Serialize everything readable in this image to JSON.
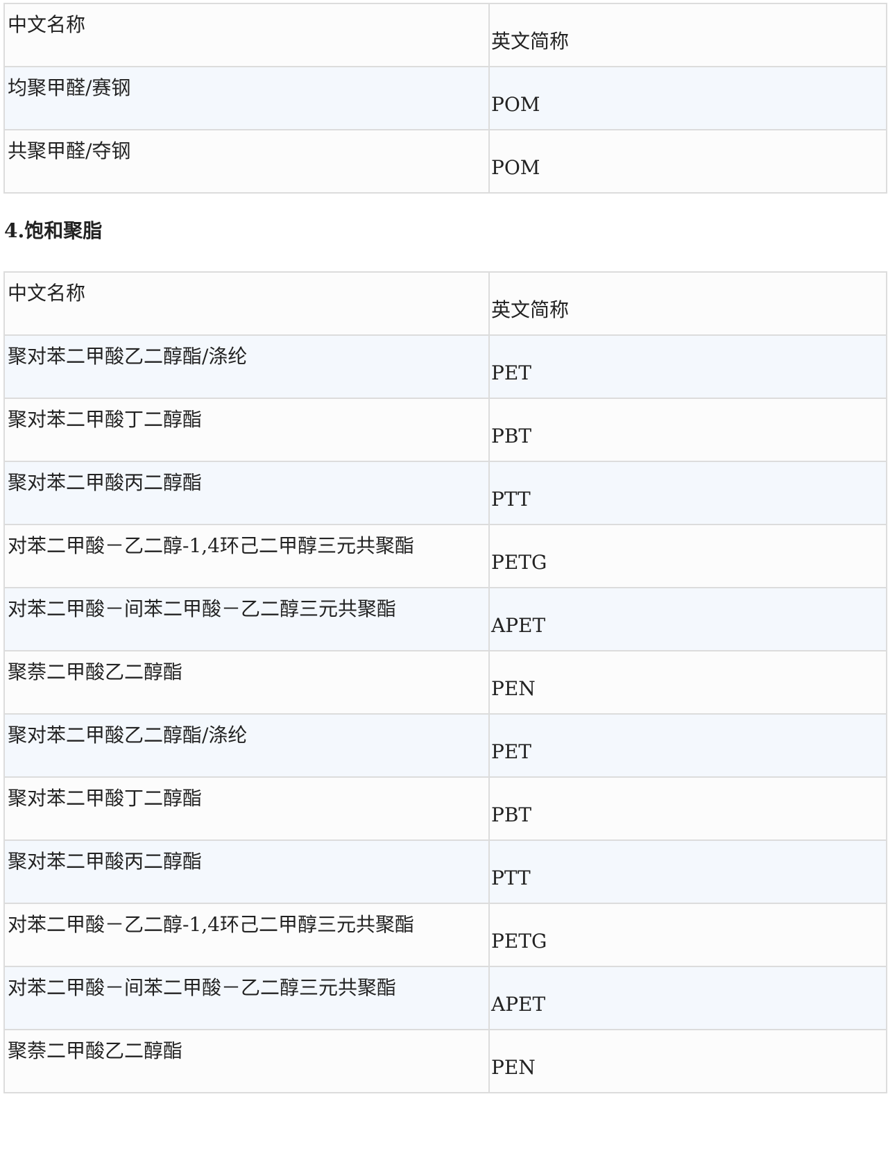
{
  "table1": {
    "header": {
      "cn": "中文名称",
      "en": "英文简称"
    },
    "rows": [
      {
        "cn": "均聚甲醛/赛钢",
        "en": "POM"
      },
      {
        "cn": "共聚甲醛/夺钢",
        "en": "POM"
      }
    ]
  },
  "section": {
    "heading": "4.饱和聚脂"
  },
  "table2": {
    "header": {
      "cn": "中文名称",
      "en": "英文简称"
    },
    "rows": [
      {
        "cn": "聚对苯二甲酸乙二醇酯/涤纶",
        "en": "PET"
      },
      {
        "cn": "聚对苯二甲酸丁二醇酯",
        "en": "PBT"
      },
      {
        "cn": "聚对苯二甲酸丙二醇酯",
        "en": "PTT"
      },
      {
        "cn": "对苯二甲酸－乙二醇-1,4环己二甲醇三元共聚酯",
        "en": "PETG"
      },
      {
        "cn": "对苯二甲酸－间苯二甲酸－乙二醇三元共聚酯",
        "en": "APET"
      },
      {
        "cn": "聚萘二甲酸乙二醇酯",
        "en": "PEN"
      },
      {
        "cn": "聚对苯二甲酸乙二醇酯/涤纶",
        "en": "PET"
      },
      {
        "cn": "聚对苯二甲酸丁二醇酯",
        "en": "PBT"
      },
      {
        "cn": "聚对苯二甲酸丙二醇酯",
        "en": "PTT"
      },
      {
        "cn": "对苯二甲酸－乙二醇-1,4环己二甲醇三元共聚酯",
        "en": "PETG"
      },
      {
        "cn": "对苯二甲酸－间苯二甲酸－乙二醇三元共聚酯",
        "en": "APET"
      },
      {
        "cn": "聚萘二甲酸乙二醇酯",
        "en": "PEN"
      }
    ]
  },
  "colors": {
    "row_odd": "#fcfcfc",
    "row_even": "#f4f8fd",
    "border": "#dcdcdc",
    "text": "#222222"
  }
}
